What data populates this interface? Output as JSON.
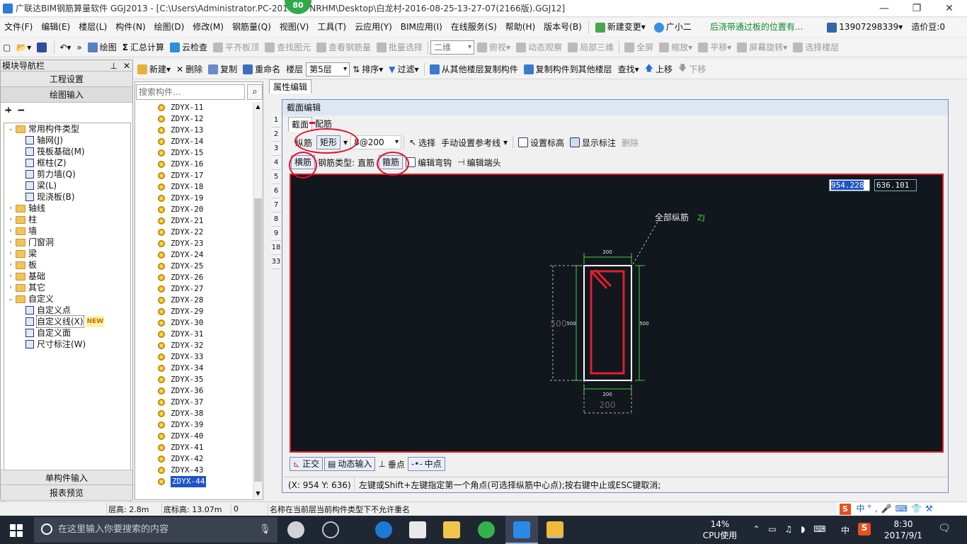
{
  "window": {
    "title": "广联达BIM钢筋算量软件 GGJ2013 - [C:\\Users\\Administrator.PC-201        NRHM\\Desktop\\白龙村-2016-08-25-13-27-07(2166版).GGJ12]",
    "badge": "80"
  },
  "menu": {
    "items": [
      "文件(F)",
      "编辑(E)",
      "楼层(L)",
      "构件(N)",
      "绘图(D)",
      "修改(M)",
      "钢筋量(Q)",
      "视图(V)",
      "工具(T)",
      "云应用(Y)",
      "BIM应用(I)",
      "在线服务(S)",
      "帮助(H)",
      "版本号(B)"
    ],
    "new_change": "新建变更",
    "guangxiaoer": "广小二",
    "hint": "后浇带通过板的位置有...",
    "phone": "13907298339",
    "price": "造价豆:0"
  },
  "toolbar1": {
    "draw": "绘图",
    "sum": "汇总计算",
    "cloud_check": "云检查",
    "flat_top": "平齐板顶",
    "find_elem": "查找图元",
    "view_rebar": "查看钢筋量",
    "batch_select": "批量选择",
    "view_mode": "二维",
    "top_view": "俯视",
    "dyn_view": "动态观察",
    "local3d": "局部三维",
    "fullscreen": "全屏",
    "zoom": "缩放",
    "pan": "平移",
    "rotate": "屏幕旋转",
    "select_floor": "选择楼层"
  },
  "toolbar2": {
    "new": "新建",
    "delete": "删除",
    "copy": "复制",
    "rename": "重命名",
    "floor_label": "楼层",
    "floor_value": "第5层",
    "sort": "排序",
    "filter": "过滤",
    "copy_from": "从其他楼层复制构件",
    "copy_to": "复制构件到其他楼层",
    "find": "查找",
    "up": "上移",
    "down": "下移"
  },
  "nav": {
    "header": "模块导航栏",
    "btn_project": "工程设置",
    "btn_draw": "绘图输入",
    "btn_single": "单构件输入",
    "btn_report": "报表预览",
    "tree": [
      {
        "label": "常用构件类型",
        "level": 0,
        "type": "folder",
        "open": true
      },
      {
        "label": "轴网(J)",
        "level": 1,
        "type": "leaf"
      },
      {
        "label": "筏板基础(M)",
        "level": 1,
        "type": "leaf"
      },
      {
        "label": "框柱(Z)",
        "level": 1,
        "type": "leaf"
      },
      {
        "label": "剪力墙(Q)",
        "level": 1,
        "type": "leaf"
      },
      {
        "label": "梁(L)",
        "level": 1,
        "type": "leaf"
      },
      {
        "label": "现浇板(B)",
        "level": 1,
        "type": "leaf"
      },
      {
        "label": "轴线",
        "level": 0,
        "type": "folder"
      },
      {
        "label": "柱",
        "level": 0,
        "type": "folder"
      },
      {
        "label": "墙",
        "level": 0,
        "type": "folder"
      },
      {
        "label": "门窗洞",
        "level": 0,
        "type": "folder"
      },
      {
        "label": "梁",
        "level": 0,
        "type": "folder"
      },
      {
        "label": "板",
        "level": 0,
        "type": "folder"
      },
      {
        "label": "基础",
        "level": 0,
        "type": "folder"
      },
      {
        "label": "其它",
        "level": 0,
        "type": "folder"
      },
      {
        "label": "自定义",
        "level": 0,
        "type": "folder",
        "open": true
      },
      {
        "label": "自定义点",
        "level": 1,
        "type": "leaf"
      },
      {
        "label": "自定义线(X)",
        "level": 1,
        "type": "leaf",
        "badge": "NEW"
      },
      {
        "label": "自定义面",
        "level": 1,
        "type": "leaf"
      },
      {
        "label": "尺寸标注(W)",
        "level": 1,
        "type": "leaf"
      }
    ]
  },
  "list": {
    "search_placeholder": "搜索构件...",
    "items": [
      "ZDYX-11",
      "ZDYX-12",
      "ZDYX-13",
      "ZDYX-14",
      "ZDYX-15",
      "ZDYX-16",
      "ZDYX-17",
      "ZDYX-18",
      "ZDYX-19",
      "ZDYX-20",
      "ZDYX-21",
      "ZDYX-22",
      "ZDYX-23",
      "ZDYX-24",
      "ZDYX-25",
      "ZDYX-26",
      "ZDYX-27",
      "ZDYX-28",
      "ZDYX-29",
      "ZDYX-30",
      "ZDYX-31",
      "ZDYX-32",
      "ZDYX-33",
      "ZDYX-34",
      "ZDYX-35",
      "ZDYX-36",
      "ZDYX-37",
      "ZDYX-38",
      "ZDYX-39",
      "ZDYX-40",
      "ZDYX-41",
      "ZDYX-42",
      "ZDYX-43",
      "ZDYX-44"
    ],
    "selected": "ZDYX-44"
  },
  "prop": {
    "tab": "属性编辑",
    "rows": [
      "1",
      "2",
      "3",
      "4",
      "5",
      "6",
      "7",
      "8",
      "9",
      "18",
      "33"
    ]
  },
  "dialog": {
    "title": "截面编辑",
    "tab_section": "截面",
    "tab_rebar": "配筋",
    "long_rebar": "纵筋",
    "shape": "矩形",
    "spec": "8@200",
    "select": "选择",
    "ref_line": "手动设置参考线",
    "set_elev": "设置标高",
    "show_dim": "显示标注",
    "delete": "删除",
    "horiz_rebar": "横筋",
    "rebar_type_label": "钢筋类型:",
    "rebar_type_value": "直筋",
    "stirrup": "箍筋",
    "edit_hook": "编辑弯钩",
    "edit_end": "编辑端头",
    "coord_x": "954.228",
    "coord_y": "636.101",
    "canvas": {
      "label": "全部纵筋",
      "label_code": "ZJ",
      "dim_top": "200",
      "dim_bottom": "200",
      "dim_left": "500",
      "dim_right": "500",
      "dim_left_outer": "500",
      "dim_bottom_outer": "200"
    },
    "ortho": "正交",
    "dyn_input": "动态输入",
    "perp": "垂点",
    "mid": "中点",
    "status_coord": "(X: 954 Y: 636)",
    "status_msg": "左键或Shift+左键指定第一个角点(可选择纵筋中心点);按右键中止或ESC键取消;"
  },
  "status": {
    "floor_h": "层高: 2.8m",
    "bottom_h": "底标高: 13.07m",
    "zero": "0",
    "msg": "名称在当前层当前构件类型下不允许重名"
  },
  "taskbar": {
    "search": "在这里输入你要搜索的内容",
    "cpu_pct": "14%",
    "cpu_label": "CPU使用",
    "time": "8:30",
    "date": "2017/9/1",
    "ime": "中",
    "ime2": "中"
  },
  "colors": {
    "accent": "#1e53c9",
    "canvas_bg": "#12161d",
    "highlight": "#e0202a",
    "dim_green": "#3fd43f",
    "rebar_red": "#e0202a"
  }
}
